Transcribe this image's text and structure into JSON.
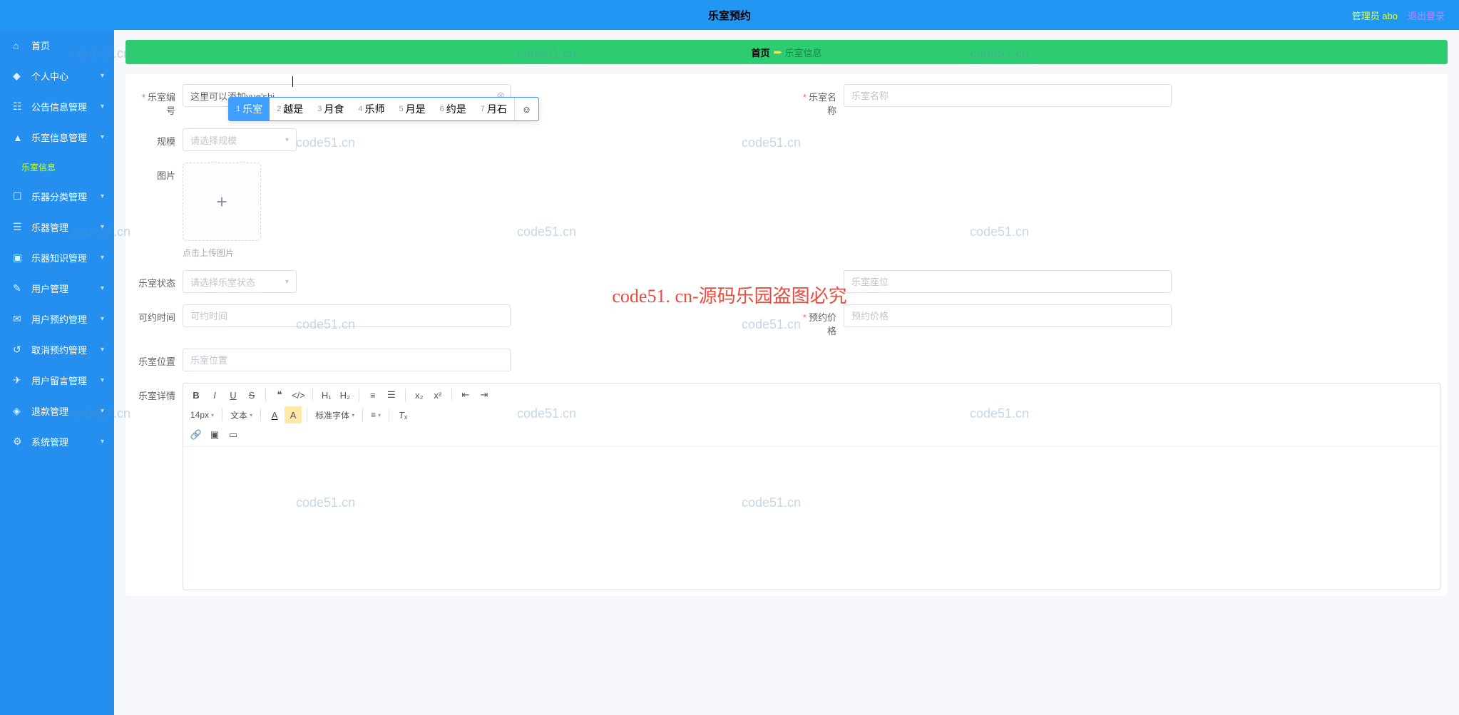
{
  "header": {
    "title": "乐室预约",
    "admin": "管理员 abo",
    "logout": "退出登录"
  },
  "sidebar": {
    "items": [
      {
        "icon": "⌂",
        "label": "首页",
        "chev": false
      },
      {
        "icon": "◆",
        "label": "个人中心",
        "chev": true
      },
      {
        "icon": "☷",
        "label": "公告信息管理",
        "chev": true
      },
      {
        "icon": "▲",
        "label": "乐室信息管理",
        "chev": true,
        "sub": "乐室信息"
      },
      {
        "icon": "☐",
        "label": "乐器分类管理",
        "chev": true
      },
      {
        "icon": "☰",
        "label": "乐器管理",
        "chev": true
      },
      {
        "icon": "▣",
        "label": "乐器知识管理",
        "chev": true
      },
      {
        "icon": "✎",
        "label": "用户管理",
        "chev": true
      },
      {
        "icon": "✉",
        "label": "用户预约管理",
        "chev": true
      },
      {
        "icon": "↺",
        "label": "取消预约管理",
        "chev": true
      },
      {
        "icon": "✈",
        "label": "用户留言管理",
        "chev": true
      },
      {
        "icon": "◈",
        "label": "退款管理",
        "chev": true
      },
      {
        "icon": "⚙",
        "label": "系统管理",
        "chev": true
      }
    ]
  },
  "breadcrumb": {
    "home": "首页",
    "current": "乐室信息"
  },
  "form": {
    "room_no": {
      "label": "乐室编号",
      "value": "这里可以添加yue'shi"
    },
    "room_name": {
      "label": "乐室名称",
      "placeholder": "乐室名称"
    },
    "scale": {
      "label": "规模",
      "placeholder": "请选择规模"
    },
    "image": {
      "label": "图片",
      "hint": "点击上传图片"
    },
    "status": {
      "label": "乐室状态",
      "placeholder": "请选择乐室状态"
    },
    "seats": {
      "label": "",
      "placeholder": "乐室座位"
    },
    "time": {
      "label": "可约时间",
      "placeholder": "可约时间"
    },
    "price": {
      "label": "预约价格",
      "placeholder": "预约价格"
    },
    "location": {
      "label": "乐室位置",
      "placeholder": "乐室位置"
    },
    "detail": {
      "label": "乐室详情"
    }
  },
  "ime": {
    "candidates": [
      {
        "n": "1",
        "t": "乐室"
      },
      {
        "n": "2",
        "t": "越是"
      },
      {
        "n": "3",
        "t": "月食"
      },
      {
        "n": "4",
        "t": "乐师"
      },
      {
        "n": "5",
        "t": "月是"
      },
      {
        "n": "6",
        "t": "约是"
      },
      {
        "n": "7",
        "t": "月石"
      }
    ]
  },
  "editor": {
    "font_size": "14px",
    "font_type": "文本",
    "font_family": "标准字体"
  },
  "watermark": {
    "text": "code51.cn",
    "big": "code51. cn-源码乐园盗图必究"
  }
}
